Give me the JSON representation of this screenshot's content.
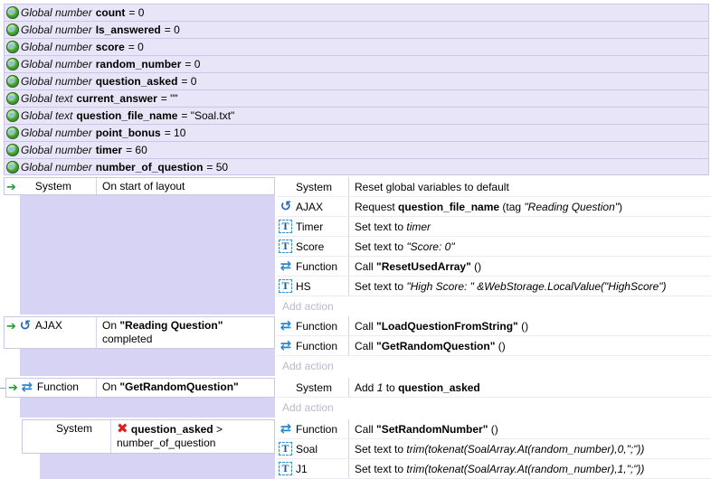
{
  "globals": [
    {
      "kind": "Global number",
      "name": "count",
      "value": "= 0"
    },
    {
      "kind": "Global number",
      "name": "Is_answered",
      "value": "= 0"
    },
    {
      "kind": "Global number",
      "name": "score",
      "value": "= 0"
    },
    {
      "kind": "Global number",
      "name": "random_number",
      "value": "= 0"
    },
    {
      "kind": "Global number",
      "name": "question_asked",
      "value": "= 0"
    },
    {
      "kind": "Global text",
      "name": "current_answer",
      "value": "= \"\""
    },
    {
      "kind": "Global text",
      "name": "question_file_name",
      "value": "= \"Soal.txt\""
    },
    {
      "kind": "Global number",
      "name": "point_bonus",
      "value": "= 10"
    },
    {
      "kind": "Global number",
      "name": "timer",
      "value": "= 60"
    },
    {
      "kind": "Global number",
      "name": "number_of_question",
      "value": "= 50"
    }
  ],
  "events": {
    "e1": {
      "object": "System",
      "condition": "On start of layout",
      "actions": [
        {
          "object": "System",
          "text": "Reset global variables to default"
        },
        {
          "object": "AJAX",
          "pre": "Request ",
          "bold": "question_file_name",
          "post": " (tag ",
          "italic": "\"Reading Question\"",
          "end": ")"
        },
        {
          "object": "Timer",
          "pre": "Set text to ",
          "italic": "timer"
        },
        {
          "object": "Score",
          "pre": "Set text to ",
          "italic": "\"Score: 0\""
        },
        {
          "object": "Function",
          "pre": "Call ",
          "bold": "\"ResetUsedArray\"",
          "post": " ()"
        },
        {
          "object": "HS",
          "pre": "Set text to ",
          "italic": "\"High Score: \" &WebStorage.LocalValue(\"HighScore\")"
        }
      ],
      "add_action": "Add action"
    },
    "e2": {
      "object": "AJAX",
      "cond_pre": "On ",
      "cond_bold": "\"Reading Question\"",
      "cond_post": "completed",
      "actions": [
        {
          "object": "Function",
          "pre": "Call ",
          "bold": "\"LoadQuestionFromString\"",
          "post": " ()"
        },
        {
          "object": "Function",
          "pre": "Call ",
          "bold": "\"GetRandomQuestion\"",
          "post": " ()"
        }
      ],
      "add_action": "Add action"
    },
    "e3": {
      "object": "Function",
      "cond_pre": "On ",
      "cond_bold": "\"GetRandomQuestion\"",
      "actions": [
        {
          "object": "System",
          "pre": "Add ",
          "italic": "1",
          "post": " to ",
          "bold": "question_asked"
        }
      ],
      "add_action": "Add action"
    },
    "e4": {
      "object": "System",
      "cond_bold": "question_asked",
      "cond_post": " >",
      "cond_line2": "number_of_question",
      "actions": [
        {
          "object": "Function",
          "pre": "Call ",
          "bold": "\"SetRandomNumber\"",
          "post": " ()"
        },
        {
          "object": "Soal",
          "pre": "Set text to ",
          "italic": "trim(tokenat(SoalArray.At(random_number),0,\";\"))"
        },
        {
          "object": "J1",
          "pre": "Set text to ",
          "italic": "trim(tokenat(SoalArray.At(random_number),1,\";\"))"
        }
      ]
    }
  }
}
